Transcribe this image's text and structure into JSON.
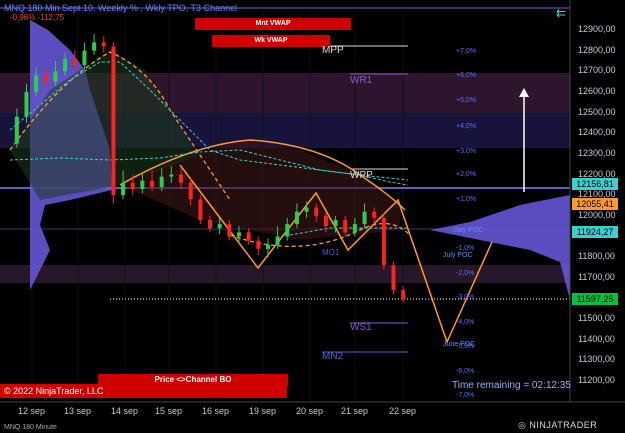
{
  "header": {
    "title": "MNQ 180 Min Sept 10, Weekly % , Wkly TPO, T3 Channel",
    "change": "-0,96%   -112,75",
    "back_glyph": "⇇"
  },
  "labels": {
    "mnt_vwap": "Mnt VWAP",
    "wk_vwap": "Wk VWAP",
    "channel_bo": "Price <>Channel BO"
  },
  "levels": {
    "mpp": "MPP",
    "wr1": "WR1",
    "wpp": "WPP",
    "ws1": "WS1",
    "mn2": "MN2",
    "mo1": "MO1",
    "mpoc": "May POC",
    "july_poc": "July POC",
    "june_poc": "June POC"
  },
  "percent_scale": [
    "+7,0%",
    "+6,0%",
    "+5,0%",
    "+4,0%",
    "+3,0%",
    "+2,0%",
    "+1,0%",
    "-1,0%",
    "-2,0%",
    "-3,0%",
    "-4,0%",
    "-5,0%",
    "-6,0%",
    "-7,0%"
  ],
  "price_scale": [
    "12900,00",
    "12800,00",
    "12700,00",
    "12600,00",
    "12500,00",
    "12400,00",
    "12300,00",
    "12200,00",
    "12100,00",
    "12000,00",
    "11800,00",
    "11700,00",
    "11600,00",
    "11500,00",
    "11400,00",
    "11300,00",
    "11200,00"
  ],
  "badges": [
    "12156,81",
    "12055,41",
    "11924,27",
    "11597,25"
  ],
  "dates": [
    "12 sep",
    "13 sep",
    "14 sep",
    "15 sep",
    "16 sep",
    "19 sep",
    "20 sep",
    "21 sep",
    "22 sep"
  ],
  "footer": {
    "copyright": "© 2022 NinjaTrader, LLC",
    "time_remaining": "Time remaining = 02:12:35",
    "instrument": "MNQ 180 Minute",
    "logo": "◎ NINJATRADER"
  },
  "chart_data": {
    "type": "candlestick",
    "x": [
      "12 sep",
      "13 sep",
      "14 sep",
      "15 sep",
      "16 sep",
      "19 sep",
      "20 sep",
      "21 sep",
      "22 sep"
    ],
    "ylim": [
      11200,
      12900
    ],
    "candles": [
      {
        "o": 12350,
        "c": 12480,
        "h": 12520,
        "l": 12330
      },
      {
        "o": 12480,
        "c": 12600,
        "h": 12640,
        "l": 12450
      },
      {
        "o": 12600,
        "c": 12680,
        "h": 12720,
        "l": 12580
      },
      {
        "o": 12680,
        "c": 12650,
        "h": 12720,
        "l": 12620
      },
      {
        "o": 12650,
        "c": 12700,
        "h": 12750,
        "l": 12630
      },
      {
        "o": 12700,
        "c": 12760,
        "h": 12790,
        "l": 12680
      },
      {
        "o": 12760,
        "c": 12730,
        "h": 12800,
        "l": 12700
      },
      {
        "o": 12730,
        "c": 12800,
        "h": 12840,
        "l": 12710
      },
      {
        "o": 12800,
        "c": 12840,
        "h": 12880,
        "l": 12780
      },
      {
        "o": 12840,
        "c": 12820,
        "h": 12870,
        "l": 12790
      },
      {
        "o": 12820,
        "c": 12100,
        "h": 12840,
        "l": 12060
      },
      {
        "o": 12100,
        "c": 12160,
        "h": 12220,
        "l": 12080
      },
      {
        "o": 12160,
        "c": 12130,
        "h": 12200,
        "l": 12100
      },
      {
        "o": 12130,
        "c": 12170,
        "h": 12210,
        "l": 12110
      },
      {
        "o": 12170,
        "c": 12140,
        "h": 12220,
        "l": 12120
      },
      {
        "o": 12140,
        "c": 12190,
        "h": 12230,
        "l": 12120
      },
      {
        "o": 12190,
        "c": 12200,
        "h": 12240,
        "l": 12160
      },
      {
        "o": 12200,
        "c": 12160,
        "h": 12230,
        "l": 12130
      },
      {
        "o": 12160,
        "c": 12080,
        "h": 12180,
        "l": 12050
      },
      {
        "o": 12080,
        "c": 11980,
        "h": 12100,
        "l": 11960
      },
      {
        "o": 11980,
        "c": 11940,
        "h": 12000,
        "l": 11920
      },
      {
        "o": 11940,
        "c": 11960,
        "h": 11990,
        "l": 11910
      },
      {
        "o": 11960,
        "c": 11900,
        "h": 11980,
        "l": 11880
      },
      {
        "o": 11900,
        "c": 11920,
        "h": 11950,
        "l": 11870
      },
      {
        "o": 11920,
        "c": 11880,
        "h": 11940,
        "l": 11860
      },
      {
        "o": 11880,
        "c": 11840,
        "h": 11900,
        "l": 11810
      },
      {
        "o": 11840,
        "c": 11860,
        "h": 11890,
        "l": 11800
      },
      {
        "o": 11860,
        "c": 11900,
        "h": 11950,
        "l": 11840
      },
      {
        "o": 11900,
        "c": 11960,
        "h": 11990,
        "l": 11880
      },
      {
        "o": 11960,
        "c": 12020,
        "h": 12060,
        "l": 11940
      },
      {
        "o": 12020,
        "c": 12040,
        "h": 12070,
        "l": 11990
      },
      {
        "o": 12040,
        "c": 12000,
        "h": 12060,
        "l": 11970
      },
      {
        "o": 12000,
        "c": 11950,
        "h": 12020,
        "l": 11920
      },
      {
        "o": 11950,
        "c": 11980,
        "h": 12000,
        "l": 11920
      },
      {
        "o": 11980,
        "c": 11920,
        "h": 12000,
        "l": 11900
      },
      {
        "o": 11920,
        "c": 11960,
        "h": 11990,
        "l": 11900
      },
      {
        "o": 11960,
        "c": 12020,
        "h": 12060,
        "l": 11940
      },
      {
        "o": 12020,
        "c": 11990,
        "h": 12040,
        "l": 11960
      },
      {
        "o": 11990,
        "c": 11760,
        "h": 12010,
        "l": 11740
      },
      {
        "o": 11760,
        "c": 11640,
        "h": 11780,
        "l": 11620
      },
      {
        "o": 11640,
        "c": 11597,
        "h": 11660,
        "l": 11580
      }
    ],
    "last_price": 11597.25,
    "percent_scale_range": [
      "-7,0%",
      "+7,0%"
    ]
  }
}
